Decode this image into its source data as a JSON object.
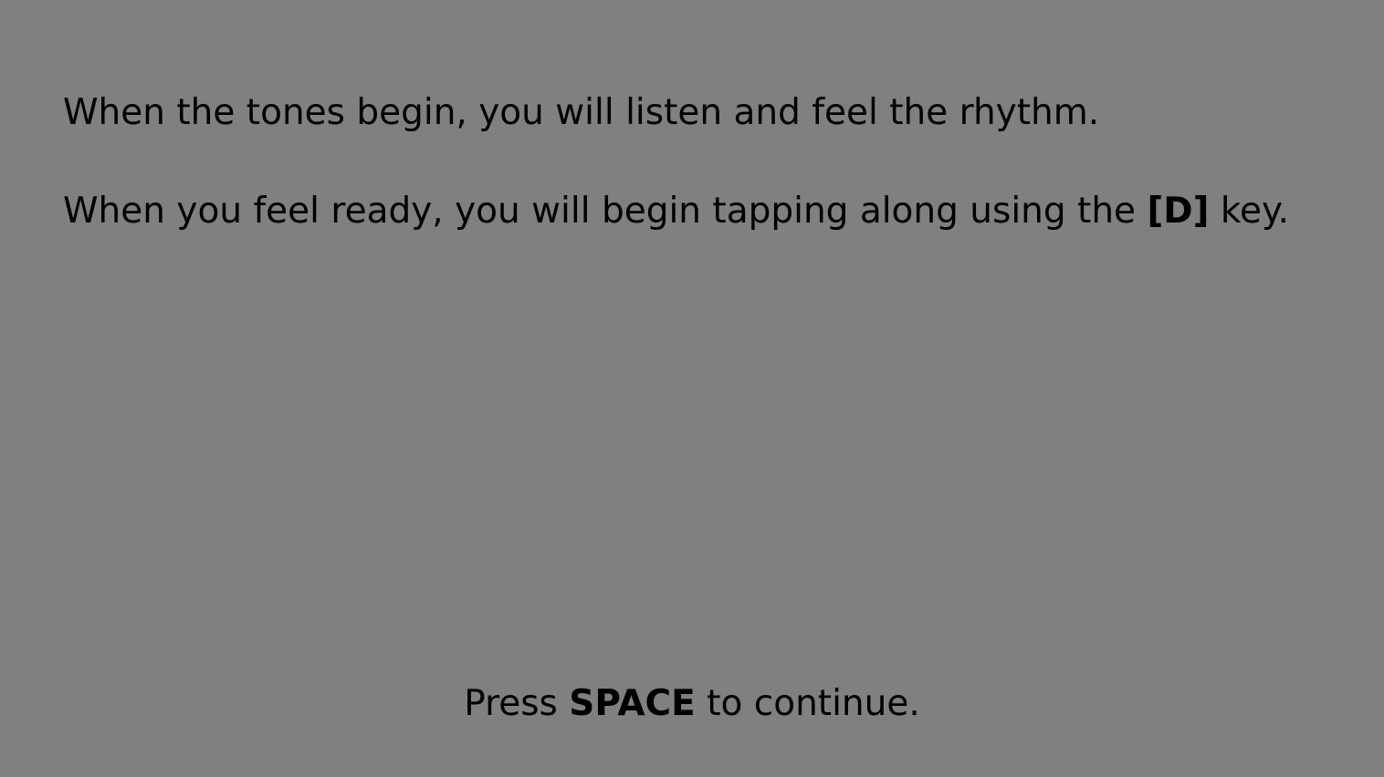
{
  "screen": {
    "background_color": "#808080",
    "text_color": "#000000"
  },
  "instructions": {
    "line1": "When the tones begin, you will listen and feel the rhythm.",
    "line2_before": "When you feel ready, you will begin tapping along using the ",
    "line2_key": "[D]",
    "line2_after": " key."
  },
  "footer": {
    "before": "Press ",
    "key": "SPACE",
    "after": " to continue."
  }
}
